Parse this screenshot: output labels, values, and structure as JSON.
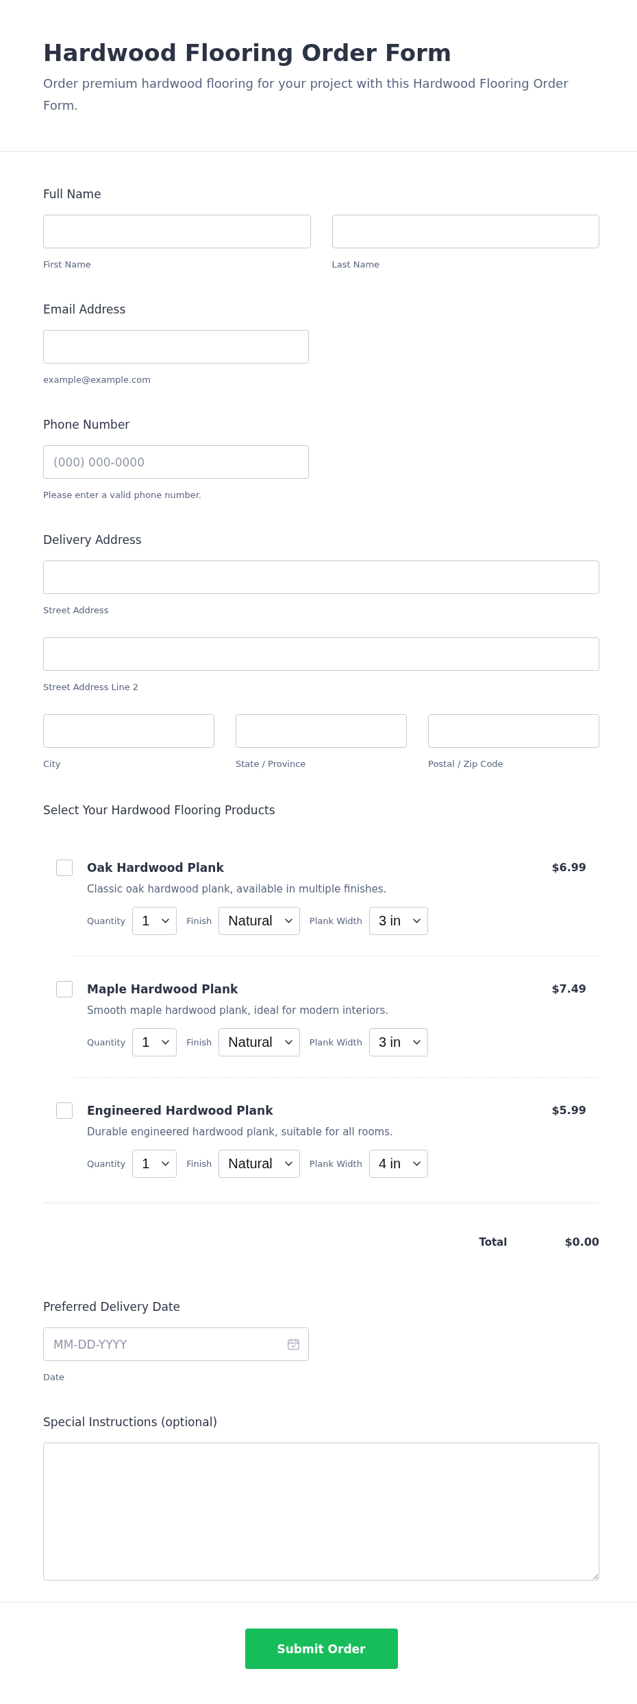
{
  "header": {
    "title": "Hardwood Flooring Order Form",
    "description": "Order premium hardwood flooring for your project with this Hardwood Flooring Order Form."
  },
  "full_name": {
    "label": "Full Name",
    "inputs": [
      {
        "sublabel": "First Name"
      },
      {
        "sublabel": "Last Name"
      }
    ]
  },
  "email": {
    "label": "Email Address",
    "sublabel": "example@example.com"
  },
  "phone": {
    "label": "Phone Number",
    "placeholder": "(000) 000-0000",
    "sublabel": "Please enter a valid phone number."
  },
  "address": {
    "label": "Delivery Address",
    "lines": [
      {
        "sublabel": "Street Address"
      },
      {
        "sublabel": "Street Address Line 2"
      }
    ],
    "parts": [
      {
        "sublabel": "City"
      },
      {
        "sublabel": "State / Province"
      },
      {
        "sublabel": "Postal / Zip Code"
      }
    ]
  },
  "products": {
    "label": "Select Your Hardwood Flooring Products",
    "items": [
      {
        "name": "Oak Hardwood Plank",
        "description": "Classic oak hardwood plank, available in multiple finishes.",
        "price": "$6.99",
        "checked": false,
        "options": [
          {
            "label": "Quantity",
            "value": "1"
          },
          {
            "label": "Finish",
            "value": "Natural"
          },
          {
            "label": "Plank Width",
            "value": "3 in"
          }
        ]
      },
      {
        "name": "Maple Hardwood Plank",
        "description": "Smooth maple hardwood plank, ideal for modern interiors.",
        "price": "$7.49",
        "checked": false,
        "options": [
          {
            "label": "Quantity",
            "value": "1"
          },
          {
            "label": "Finish",
            "value": "Natural"
          },
          {
            "label": "Plank Width",
            "value": "3 in"
          }
        ]
      },
      {
        "name": "Engineered Hardwood Plank",
        "description": "Durable engineered hardwood plank, suitable for all rooms.",
        "price": "$5.99",
        "checked": false,
        "options": [
          {
            "label": "Quantity",
            "value": "1"
          },
          {
            "label": "Finish",
            "value": "Natural"
          },
          {
            "label": "Plank Width",
            "value": "4 in"
          }
        ]
      }
    ],
    "total": {
      "label": "Total",
      "value": "$0.00"
    }
  },
  "delivery_date": {
    "label": "Preferred Delivery Date",
    "placeholder": "MM-DD-YYYY",
    "sublabel": "Date"
  },
  "special_instructions": {
    "label": "Special Instructions (optional)"
  },
  "submit_button": {
    "label": "Submit Order"
  }
}
